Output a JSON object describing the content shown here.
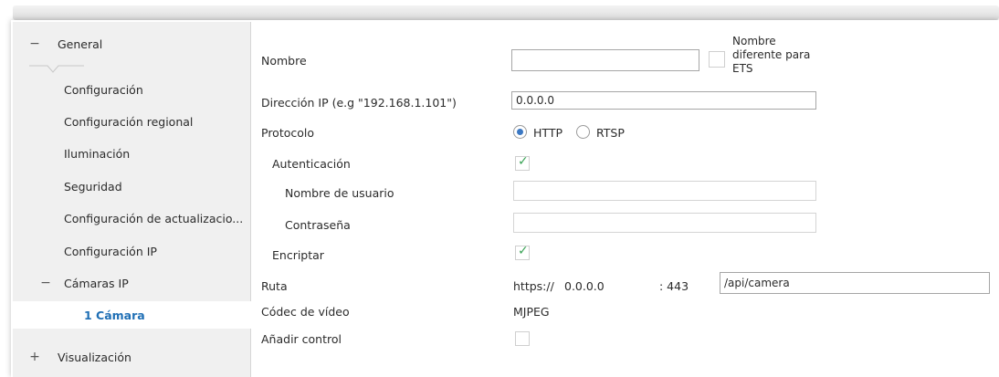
{
  "sidebar": {
    "general": {
      "symbol": "−",
      "label": "General"
    },
    "items": [
      {
        "label": "Configuración"
      },
      {
        "label": "Configuración regional"
      },
      {
        "label": "Iluminación"
      },
      {
        "label": "Seguridad"
      },
      {
        "label": "Configuración de actualizacio..."
      },
      {
        "label": "Configuración IP"
      }
    ],
    "cameras": {
      "symbol": "−",
      "label": "Cámaras IP"
    },
    "selected": {
      "label": "1 Cámara"
    },
    "visualization": {
      "symbol": "+",
      "label": "Visualización"
    }
  },
  "form": {
    "nombre_label": "Nombre",
    "nombre_value": "",
    "ets_label": "Nombre\ndiferente para\nETS",
    "ip_label": "Dirección IP (e.g \"192.168.1.101\")",
    "ip_value": "0.0.0.0",
    "protocol_label": "Protocolo",
    "protocol_http": "HTTP",
    "protocol_rtsp": "RTSP",
    "protocol_selected": "HTTP",
    "auth_label": "Autenticación",
    "auth_checked": true,
    "user_label": "Nombre de usuario",
    "user_value": "",
    "pass_label": "Contraseña",
    "pass_value": "",
    "encrypt_label": "Encriptar",
    "encrypt_checked": true,
    "route_label": "Ruta",
    "route_scheme": "https://",
    "route_host": "0.0.0.0",
    "route_port": ": 443",
    "route_path": "/api/camera",
    "codec_label": "Códec de vídeo",
    "codec_value": "MJPEG",
    "control_label": "Añadir control",
    "control_checked": false
  },
  "icons": {
    "check": "checkmark-icon"
  },
  "colors": {
    "accent": "#1f6fb5",
    "check": "#3aa356",
    "radio": "#3b78c3"
  }
}
